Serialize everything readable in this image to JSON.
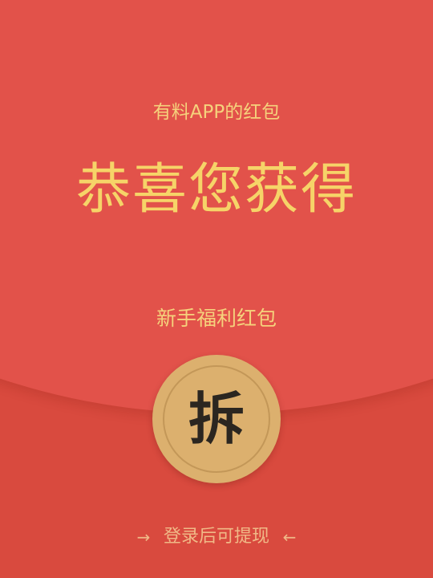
{
  "envelope": {
    "sender_label": "有料APP的红包",
    "headline": "恭喜您获得",
    "subtitle": "新手福利红包",
    "open_label": "拆",
    "footer_text": "登录后可提现",
    "arrow_left": "→",
    "arrow_right": "←"
  },
  "colors": {
    "background": "#d94a3e",
    "flap": "#e2524a",
    "gold_text": "#f6d468",
    "button_gold": "#dcb06e",
    "footer_text": "#f0b987",
    "button_label": "#2b2620"
  },
  "icons": {
    "left": "arrow-right-icon",
    "right": "arrow-left-icon"
  }
}
